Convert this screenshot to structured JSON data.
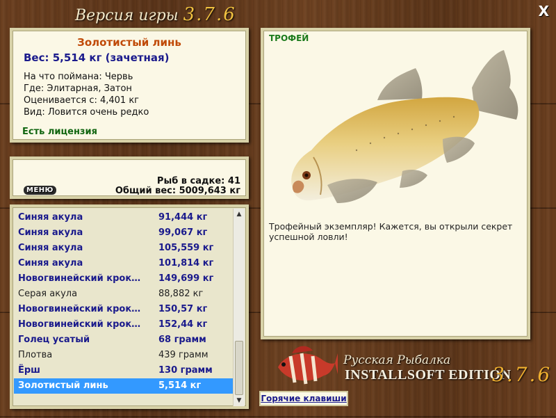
{
  "window": {
    "title": "Версия игры",
    "version": "3.7.6",
    "close_label": "X"
  },
  "info": {
    "fish_name": "Золотистый линь",
    "weight": "Вес: 5,514 кг (зачетная)",
    "rows": [
      "На что поймана: Червь",
      "Где: Элитарная, Затон",
      "Оценивается с: 4,401 кг",
      "Вид: Ловится очень редко"
    ],
    "license": "Есть лицензия"
  },
  "stats": {
    "menu_label": "МЕНЮ",
    "fish_count": "Рыб в садке: 41",
    "total_weight": "Общий вес: 5009,643 кг"
  },
  "catch_list": [
    {
      "name": "Синяя акула",
      "weight": "91,444 кг",
      "style": "bold"
    },
    {
      "name": "Синяя акула",
      "weight": "99,067 кг",
      "style": "bold"
    },
    {
      "name": "Синяя акула",
      "weight": "105,559 кг",
      "style": "bold"
    },
    {
      "name": "Синяя акула",
      "weight": "101,814 кг",
      "style": "bold"
    },
    {
      "name": "Новогвинейский кроко...",
      "weight": "149,699 кг",
      "style": "bold"
    },
    {
      "name": "Серая акула",
      "weight": "88,882 кг",
      "style": "plain"
    },
    {
      "name": "Новогвинейский кроко...",
      "weight": "150,57 кг",
      "style": "bold"
    },
    {
      "name": "Новогвинейский кроко...",
      "weight": "152,44 кг",
      "style": "bold"
    },
    {
      "name": "Голец усатый",
      "weight": "68 грамм",
      "style": "bold"
    },
    {
      "name": "Плотва",
      "weight": "439 грамм",
      "style": "plain"
    },
    {
      "name": "Ёрш",
      "weight": "130 грамм",
      "style": "bold"
    },
    {
      "name": "Золотистый линь",
      "weight": "5,514 кг",
      "style": "sel"
    }
  ],
  "trophy": {
    "tag": "ТРОФЕЙ",
    "description": "Трофейный экземпляр! Кажется, вы открыли секрет успешной ловли!"
  },
  "logo": {
    "line1": "Русская Рыбалка",
    "line2": "INSTALLSOFT EDITION",
    "version": "3.7.6"
  },
  "hotkeys_label": "Горячие клавиши",
  "colors": {
    "fish_name": "#c04a08",
    "row_bold": "#1a1a8c",
    "license": "#116611",
    "selected": "#3399ff",
    "trophy_tag": "#1b7a1b"
  }
}
